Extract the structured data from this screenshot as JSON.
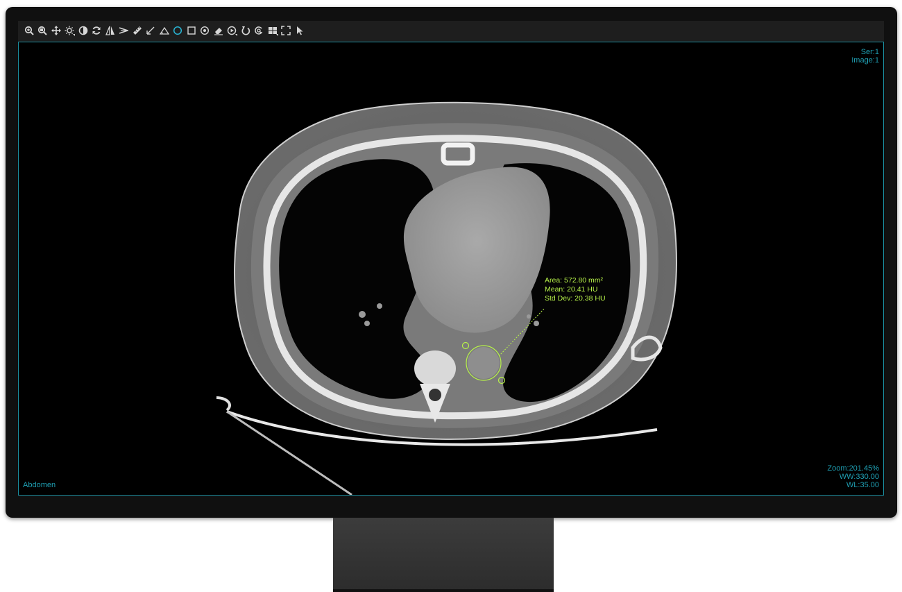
{
  "toolbar": {
    "tools": [
      {
        "name": "zoom-in",
        "icon": "zoom-in-icon",
        "menu": false,
        "active": false
      },
      {
        "name": "zoom-region",
        "icon": "zoom-region-icon",
        "menu": false,
        "active": false
      },
      {
        "name": "pan",
        "icon": "pan-icon",
        "menu": false,
        "active": false
      },
      {
        "name": "window-level",
        "icon": "brightness-icon",
        "menu": true,
        "active": false
      },
      {
        "name": "invert",
        "icon": "contrast-icon",
        "menu": false,
        "active": false
      },
      {
        "name": "reset",
        "icon": "refresh-icon",
        "menu": false,
        "active": false
      },
      {
        "name": "flip",
        "icon": "flip-icon",
        "menu": false,
        "active": false
      },
      {
        "name": "angle",
        "icon": "angle-icon",
        "menu": false,
        "active": false
      },
      {
        "name": "length",
        "icon": "ruler-icon",
        "menu": false,
        "active": false
      },
      {
        "name": "arrow-annotate",
        "icon": "arrow-icon",
        "menu": false,
        "active": false
      },
      {
        "name": "cobb-angle",
        "icon": "triangle-icon",
        "menu": false,
        "active": false
      },
      {
        "name": "ellipse-roi",
        "icon": "circle-icon",
        "menu": false,
        "active": true
      },
      {
        "name": "rectangle-roi",
        "icon": "square-icon",
        "menu": false,
        "active": false
      },
      {
        "name": "probe",
        "icon": "probe-icon",
        "menu": false,
        "active": false
      },
      {
        "name": "eraser",
        "icon": "eraser-icon",
        "menu": false,
        "active": false
      },
      {
        "name": "cine",
        "icon": "play-icon",
        "menu": true,
        "active": false
      },
      {
        "name": "rotate",
        "icon": "rotate-icon",
        "menu": false,
        "active": false
      },
      {
        "name": "magnify",
        "icon": "magnify-icon",
        "menu": false,
        "active": false
      },
      {
        "name": "layout",
        "icon": "grid-icon",
        "menu": true,
        "active": false
      },
      {
        "name": "fullscreen",
        "icon": "fullscreen-icon",
        "menu": false,
        "active": false
      },
      {
        "name": "select",
        "icon": "cursor-icon",
        "menu": false,
        "active": false
      }
    ]
  },
  "viewport": {
    "series": "Ser:1",
    "image": "Image:1",
    "zoom": "Zoom:201.45%",
    "ww": "WW:330.00",
    "wl": "WL:35.00",
    "body_part": "Abdomen"
  },
  "roi": {
    "area": "Area: 572.80 mm²",
    "mean": "Mean: 20.41 HU",
    "std_dev": "Std Dev: 20.38 HU"
  },
  "colors": {
    "overlay_text": "#1f9fb3",
    "roi": "#b7f24a",
    "active_tool": "#29b6d6",
    "viewport_border": "#1b8ea0"
  }
}
